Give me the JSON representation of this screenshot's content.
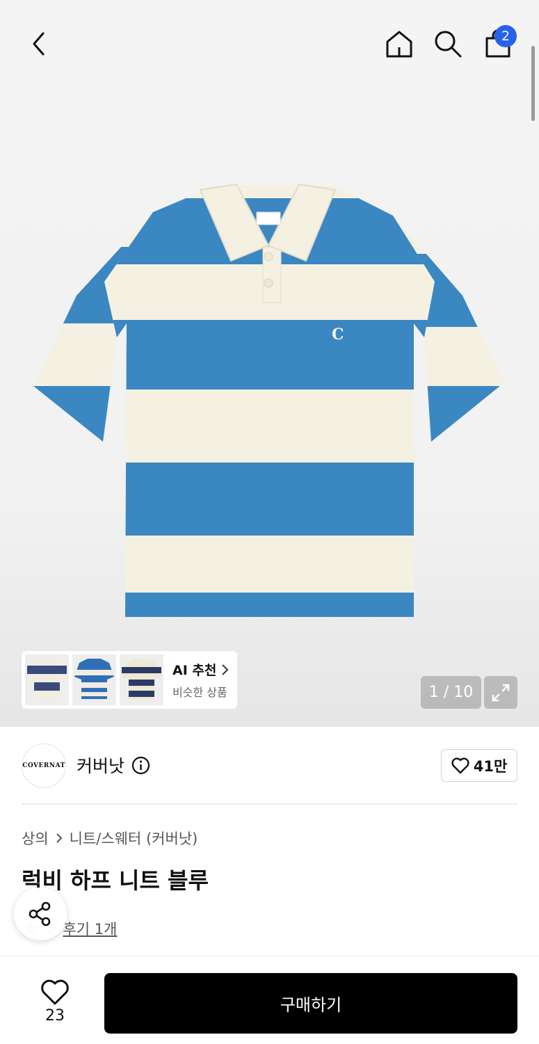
{
  "header": {
    "back_icon": "chevron-left-icon",
    "home_icon": "home-icon",
    "search_icon": "search-icon",
    "cart_icon": "shopping-bag-icon",
    "cart_count": "2"
  },
  "gallery": {
    "counter": "1 / 10",
    "expand_icon": "expand-icon",
    "ai_recommend": {
      "title": "AI 추천",
      "subtitle": "비슷한 상품"
    }
  },
  "brand": {
    "logo_text": "COVERNAT",
    "name": "커버낫",
    "info_icon": "info-icon",
    "likes": "41만"
  },
  "product": {
    "category": "상의",
    "subcategory": "니트/스웨터 (커버낫)",
    "title": "럭비 하프 니트 블루",
    "rating": "5",
    "reviews": "후기 1개"
  },
  "bottom": {
    "wish_count": "23",
    "buy_label": "구매하기"
  },
  "colors": {
    "accent_badge": "#2563eb",
    "stripe_blue": "#3a87c2",
    "stripe_cream": "#f4f1e2",
    "buy_button": "#000000"
  }
}
